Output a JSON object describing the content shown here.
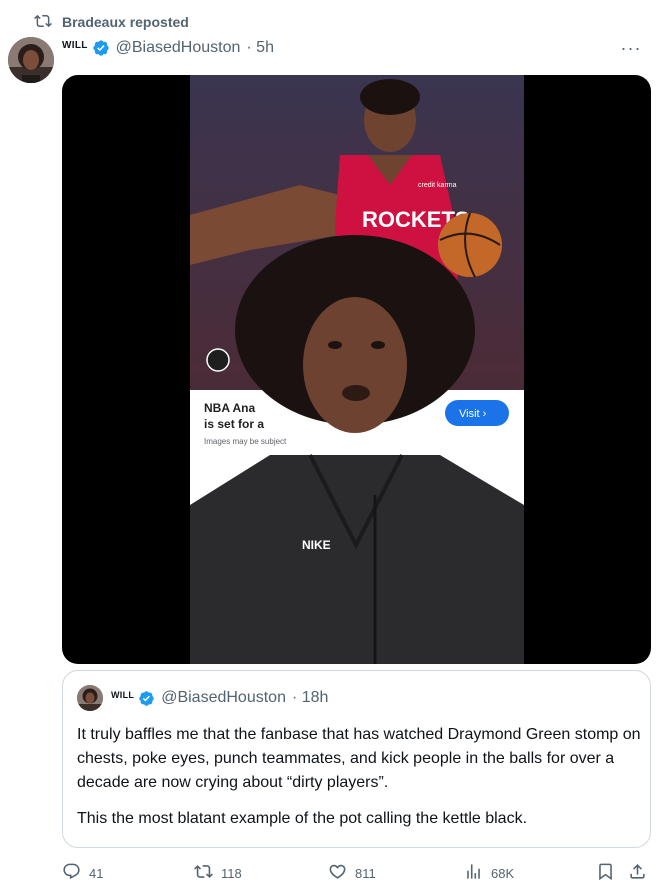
{
  "repost": {
    "text": "Bradeaux reposted"
  },
  "post": {
    "author_name": "WILL",
    "handle": "@BiasedHouston",
    "time": "· 5h",
    "more_label": "···"
  },
  "media_overlay": {
    "jersey_text": "ROCKETS",
    "sponsor_text": "credit karma",
    "ad_title_line1": "NBA Ana",
    "ad_title_line2": "is set for a",
    "ad_sub": "Images may be subject",
    "visit_label": "Visit ›",
    "hoodie_logo": "NIKE"
  },
  "quote": {
    "author_name": "WILL",
    "handle": "@BiasedHouston",
    "time": "· 18h",
    "paragraph1": "It truly baffles me that the fanbase that has watched Draymond Green stomp on chests, poke eyes, punch teammates, and kick people in the balls for over a decade are now crying about “dirty players”.",
    "paragraph2": "This the most blatant example of the pot calling the kettle black."
  },
  "actions": {
    "replies": "41",
    "reposts": "118",
    "likes": "811",
    "views": "68K"
  },
  "colors": {
    "verified": "#1d9bf0",
    "muted": "#536471",
    "jersey": "#ce1141",
    "visit": "#1d9bf0"
  }
}
